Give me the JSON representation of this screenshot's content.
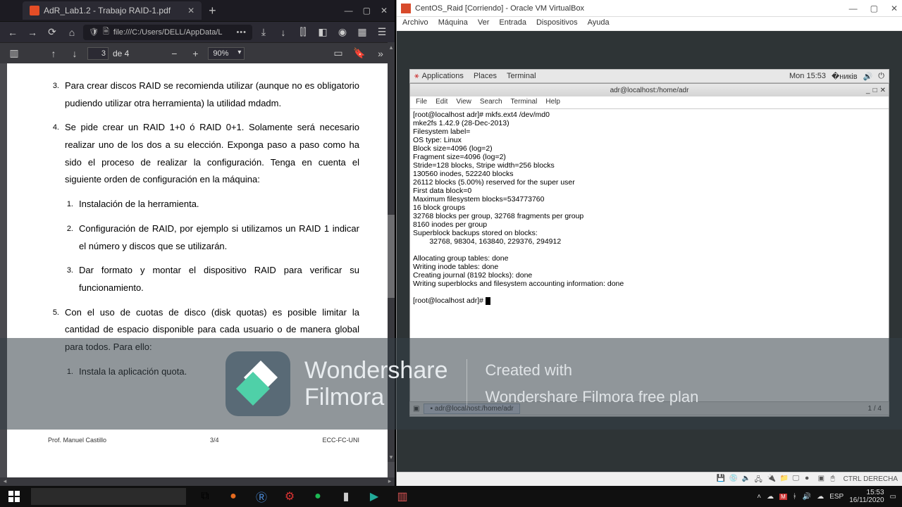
{
  "firefox": {
    "tab_title": "AdR_Lab1.2 - Trabajo RAID-1.pdf",
    "url": "file:///C:/Users/DELL/AppData/L",
    "page_current": "3",
    "page_sep": "de 4",
    "zoom": "90%",
    "doc": {
      "p3": "Para crear discos RAID se recomienda utilizar (aunque no es obligatorio pudiendo utilizar otra herramienta) la utilidad mdadm.",
      "p4": "Se pide crear un RAID 1+0 ó RAID 0+1. Solamente será necesario realizar uno de los dos a su elección. Exponga paso a paso como ha sido el proceso de realizar la configuración. Tenga en cuenta el siguiente orden de configuración en la máquina:",
      "s1": "Instalación de la herramienta.",
      "s2": "Configuración de RAID, por ejemplo si utilizamos un RAID 1 indicar el número y discos que se utilizarán.",
      "s3": "Dar formato y montar el dispositivo RAID para verificar su funcionamiento.",
      "p5": "Con el uso de cuotas de disco (disk quotas) es posible limitar la cantidad de espacio disponible para cada usuario o de manera global para todos. Para ello:",
      "s5_1": "Instala la aplicación quota.",
      "foot_l": "Prof. Manuel Castillo",
      "foot_c": "3/4",
      "foot_r": "ECC-FC-UNI"
    }
  },
  "vbox": {
    "title": "CentOS_Raid [Corriendo] - Oracle VM VirtualBox",
    "menu": [
      "Archivo",
      "Máquina",
      "Ver",
      "Entrada",
      "Dispositivos",
      "Ayuda"
    ],
    "status_key": "CTRL DERECHA"
  },
  "gnome": {
    "apps": "Applications",
    "places": "Places",
    "terminal": "Terminal",
    "clock": "Mon 15:53",
    "task_item": "adr@localhost:/home/adr",
    "workspace": "1 / 4"
  },
  "term": {
    "title": "adr@localhost:/home/adr",
    "menu": [
      "File",
      "Edit",
      "View",
      "Search",
      "Terminal",
      "Help"
    ],
    "out": "[root@localhost adr]# mkfs.ext4 /dev/md0\nmke2fs 1.42.9 (28-Dec-2013)\nFilesystem label=\nOS type: Linux\nBlock size=4096 (log=2)\nFragment size=4096 (log=2)\nStride=128 blocks, Stripe width=256 blocks\n130560 inodes, 522240 blocks\n26112 blocks (5.00%) reserved for the super user\nFirst data block=0\nMaximum filesystem blocks=534773760\n16 block groups\n32768 blocks per group, 32768 fragments per group\n8160 inodes per group\nSuperblock backups stored on blocks:\n        32768, 98304, 163840, 229376, 294912\n\nAllocating group tables: done\nWriting inode tables: done\nCreating journal (8192 blocks): done\nWriting superblocks and filesystem accounting information: done\n\n[root@localhost adr]# "
  },
  "watermark": {
    "brand1": "Wondershare",
    "brand2": "Filmora",
    "line1": "Created with",
    "line2": "Wondershare Filmora free plan"
  },
  "win": {
    "lang": "ESP",
    "time": "15:53",
    "date": "16/11/2020"
  }
}
